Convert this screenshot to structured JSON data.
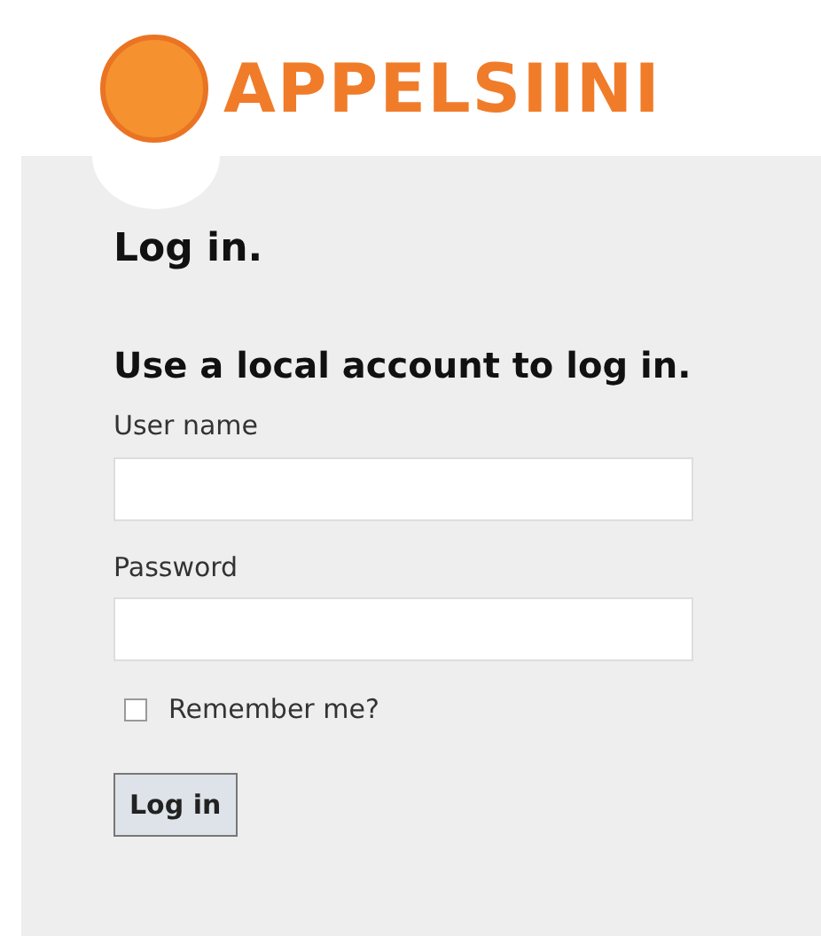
{
  "logo": {
    "text": "APPELSIINI"
  },
  "title": "Log in.",
  "subtitle": "Use a local account to log in.",
  "fields": [
    {
      "label": "User name"
    },
    {
      "label": "Password"
    }
  ],
  "remember": {
    "label": "Remember me?",
    "checked": false
  },
  "button": "Log in"
}
